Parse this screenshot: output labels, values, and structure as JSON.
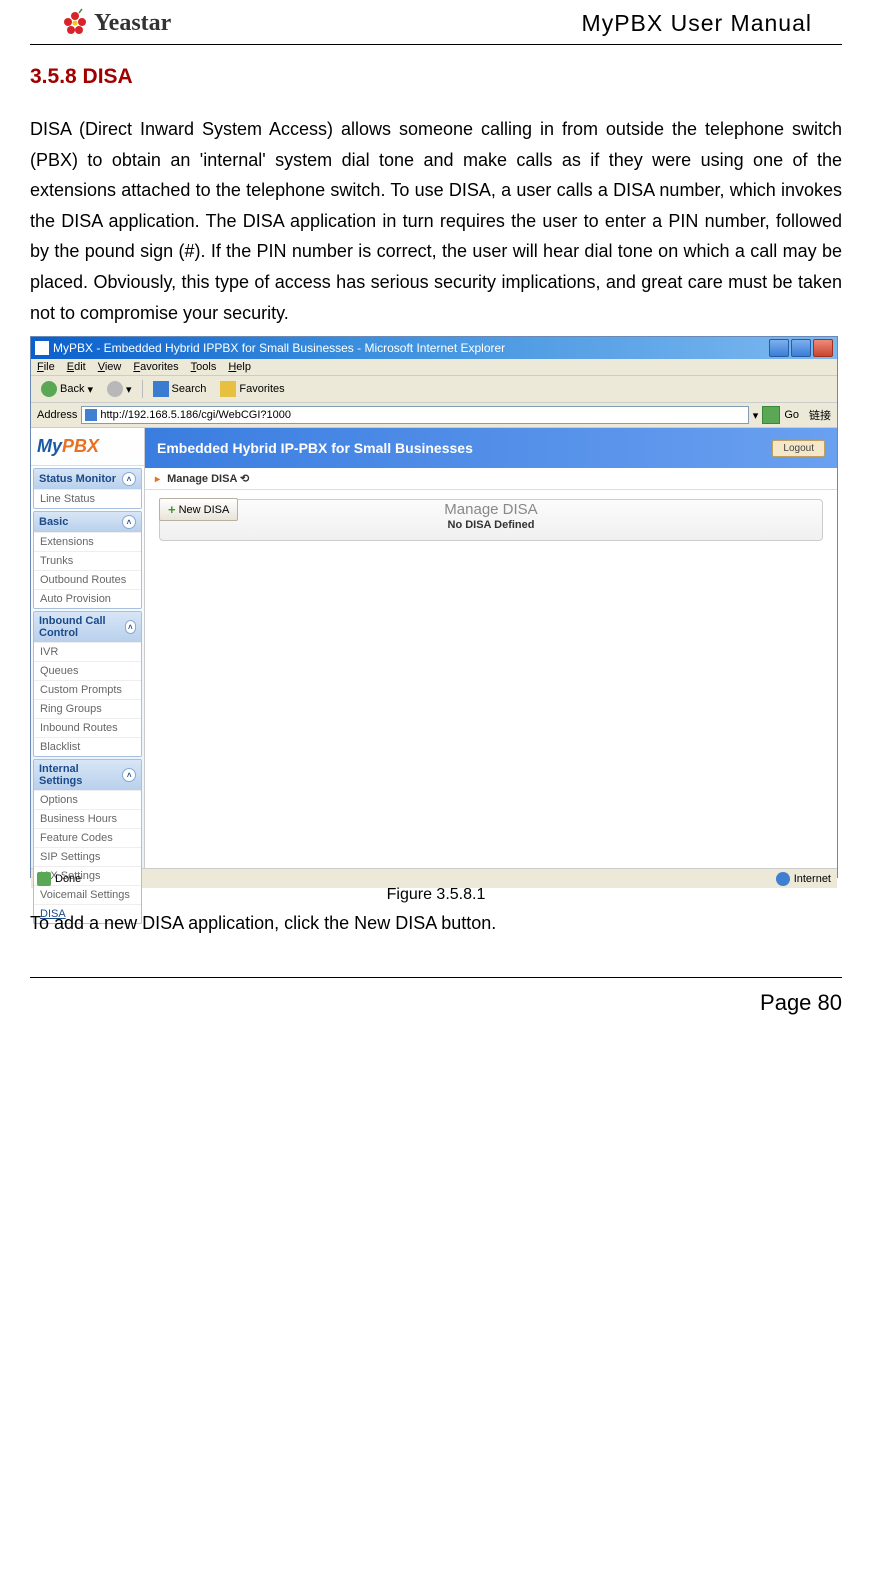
{
  "header": {
    "logo_text": "Yeastar",
    "title": "MyPBX User Manual"
  },
  "section": {
    "heading": "3.5.8 DISA",
    "paragraph": "DISA (Direct Inward System Access) allows someone calling in from outside the telephone switch (PBX) to obtain an 'internal' system dial tone and make calls as if they were using one of the extensions attached to the telephone switch. To use DISA, a user calls a DISA number, which invokes the DISA application. The DISA application in turn requires the user to enter a PIN number, followed by the pound sign (#). If the PIN number is correct, the user will hear dial tone on which a call may be placed. Obviously, this type of access has serious security implications, and great care must be taken not to compromise your security.",
    "caption": "Figure 3.5.8.1",
    "post_text": "To add a new DISA application, click the New DISA button."
  },
  "screenshot": {
    "titlebar": "MyPBX - Embedded Hybrid IPPBX for Small Businesses - Microsoft Internet Explorer",
    "menu": [
      "File",
      "Edit",
      "View",
      "Favorites",
      "Tools",
      "Help"
    ],
    "toolbar": {
      "back": "Back",
      "search": "Search",
      "favorites": "Favorites"
    },
    "address_label": "Address",
    "address_url": "http://192.168.5.186/cgi/WebCGI?1000",
    "go": "Go",
    "links": "链接",
    "logo_my": "My",
    "logo_pbx": "PBX",
    "banner": "Embedded Hybrid IP-PBX for Small Businesses",
    "logout": "Logout",
    "breadcrumb": "Manage DISA  ⟲",
    "sidebar": {
      "sections": [
        {
          "header": "Status Monitor",
          "items": [
            "Line Status"
          ]
        },
        {
          "header": "Basic",
          "items": [
            "Extensions",
            "Trunks",
            "Outbound Routes",
            "Auto Provision"
          ]
        },
        {
          "header": "Inbound Call Control",
          "items": [
            "IVR",
            "Queues",
            "Custom Prompts",
            "Ring Groups",
            "Inbound Routes",
            "Blacklist"
          ]
        },
        {
          "header": "Internal Settings",
          "items": [
            "Options",
            "Business Hours",
            "Feature Codes",
            "SIP Settings",
            "IAX Settings",
            "Voicemail Settings",
            "DISA"
          ]
        }
      ]
    },
    "main": {
      "new_button": "New DISA",
      "panel_title": "Manage DISA",
      "empty_msg": "No DISA Defined"
    },
    "status": {
      "done": "Done",
      "internet": "Internet"
    }
  },
  "footer": {
    "page": "Page 80"
  }
}
